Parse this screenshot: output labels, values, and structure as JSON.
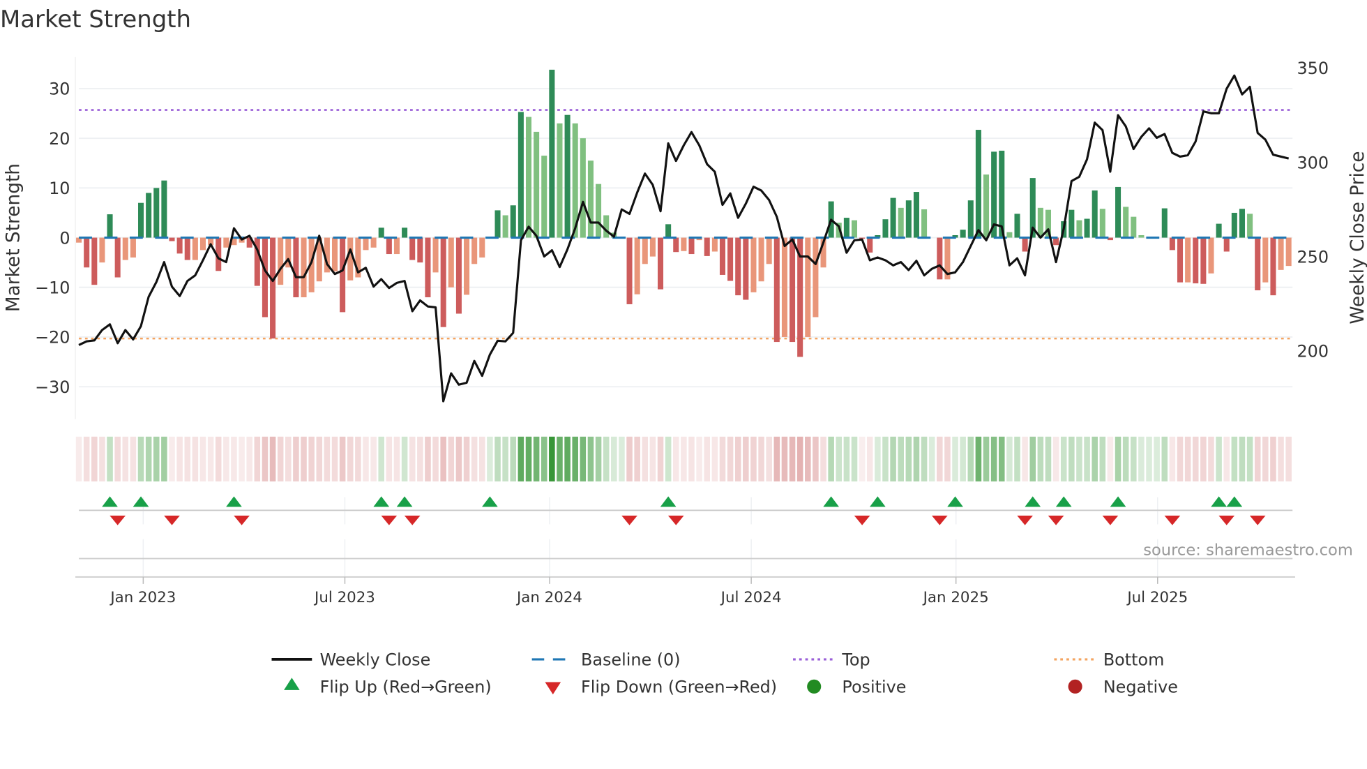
{
  "chart_data": {
    "type": "bar",
    "title": "Market Strength",
    "ylabel": "Market Strength",
    "y2label": "Weekly Close Price",
    "ylim": [
      -36,
      37
    ],
    "y2lim": [
      170,
      357
    ],
    "yticks": [
      -30,
      -20,
      -10,
      0,
      10,
      20,
      30
    ],
    "y2ticks": [
      200,
      250,
      300,
      350
    ],
    "xticks": [
      {
        "label": "Jan 2023",
        "week": 8.3
      },
      {
        "label": "Jul 2023",
        "week": 34.3
      },
      {
        "label": "Jan 2024",
        "week": 60.7
      },
      {
        "label": "Jul 2024",
        "week": 86.7
      },
      {
        "label": "Jan 2025",
        "week": 113.1
      },
      {
        "label": "Jul 2025",
        "week": 139.1
      }
    ],
    "top_level": 25.7,
    "bottom_level": -20.3,
    "baseline": 0,
    "strength": [
      -1,
      -6,
      -9.5,
      -5,
      4.7,
      -8,
      -4.5,
      -4,
      7,
      9,
      10,
      11.5,
      -0.7,
      -3.2,
      -4.5,
      -4.5,
      -2.5,
      -1.5,
      -6.7,
      -2,
      -1.5,
      -1,
      -2,
      -9.7,
      -16,
      -20.3,
      -9.5,
      -6,
      -12,
      -12,
      -11,
      -8.8,
      -7,
      -6.8,
      -15,
      -8.6,
      -8,
      -2.5,
      -2,
      2,
      -3.3,
      -3.3,
      2,
      -4.5,
      -5,
      -12,
      -7,
      -18,
      -10,
      -15.3,
      -11.5,
      -5.3,
      -4,
      0,
      5.5,
      4.5,
      6.5,
      25.3,
      24.3,
      21.3,
      16.5,
      33.8,
      23,
      24.7,
      23,
      20,
      15.5,
      10.8,
      4.5,
      1,
      0,
      -13.4,
      -11.4,
      -5.3,
      -3.8,
      -10.4,
      2.7,
      -2.9,
      -2.7,
      -3.3,
      -0.5,
      -3.7,
      -2.8,
      -7.5,
      -8.7,
      -11.6,
      -12.5,
      -11,
      -8.8,
      -5.3,
      -21,
      -20,
      -21,
      -24,
      -20,
      -16,
      -6,
      7.3,
      3,
      4,
      3.5,
      -0.2,
      -3,
      0.5,
      3.7,
      8,
      6,
      7.5,
      9.2,
      5.7,
      0,
      -8.4,
      -8.4,
      0.5,
      1.6,
      7.5,
      21.7,
      12.7,
      17.3,
      17.5,
      1.1,
      4.8,
      -2.8,
      12,
      6,
      5.6,
      -1.5,
      3.3,
      5.6,
      3.5,
      3.8,
      9.5,
      5.8,
      -0.5,
      10.2,
      6.2,
      4.2,
      0.5,
      0,
      0,
      5.9,
      -2.5,
      -9,
      -9,
      -9.2,
      -9.3,
      -7.2,
      2.8,
      -2.8,
      5,
      5.8,
      4.8,
      -10.6,
      -9,
      -11.6,
      -6.5,
      -5.7
    ],
    "weekly_close": [
      203,
      205,
      205.5,
      211,
      214,
      204,
      211,
      206,
      213,
      228.6,
      236.5,
      247,
      234,
      229,
      237,
      240,
      248,
      256.5,
      249,
      247,
      265,
      259,
      261,
      253.7,
      242.6,
      237,
      243.5,
      248.6,
      239,
      239,
      247,
      261,
      246,
      240.7,
      242.6,
      253.7,
      241.6,
      244,
      234,
      238,
      233.3,
      236,
      237,
      221,
      226.7,
      223.5,
      223,
      173.2,
      188,
      182,
      183,
      194.6,
      186.7,
      197.9,
      205.3,
      205,
      209.5,
      258.6,
      265.8,
      261,
      250,
      253.3,
      244.4,
      253.7,
      265,
      279,
      268,
      268,
      263.7,
      260.5,
      275,
      272.6,
      284,
      294,
      288,
      274,
      310,
      300.7,
      309,
      316,
      309,
      299,
      295,
      277.4,
      283.5,
      270.5,
      278,
      287,
      285,
      280,
      271,
      255.6,
      259,
      250,
      250,
      246,
      257.4,
      269.5,
      266,
      252,
      258.6,
      259,
      248,
      249.5,
      248,
      245.3,
      247,
      242.8,
      247.7,
      240,
      243.5,
      245.3,
      240.7,
      241.6,
      247,
      255.6,
      264,
      258.6,
      267,
      266,
      245.3,
      249,
      240,
      265.3,
      260,
      264.4,
      247,
      265,
      290,
      292.3,
      301.6,
      321,
      317,
      295,
      325,
      319,
      307,
      313.5,
      318,
      313,
      315,
      305,
      303,
      303.7,
      311,
      327,
      326,
      326,
      339,
      346,
      336,
      340,
      315.6,
      312,
      304,
      303,
      302
    ],
    "flip_up_weeks": [
      4,
      8,
      20,
      39,
      42,
      53,
      76,
      97,
      103,
      113,
      123,
      127,
      134,
      147,
      149
    ],
    "flip_down_weeks": [
      5,
      12,
      21,
      40,
      43,
      71,
      77,
      101,
      111,
      122,
      126,
      133,
      141,
      148,
      152
    ],
    "colors": {
      "rising_positive": "#2e8b57",
      "falling_positive": "#80c080",
      "falling_negative": "#cd5c5c",
      "rising_negative": "#e9967a",
      "close": "#111111",
      "baseline": "#1f77b4",
      "top": "#9a5fd8",
      "bottom": "#f4a460",
      "flip_up": "#18a048",
      "flip_down": "#d62728",
      "positive": "#228b22",
      "negative": "#b22222"
    },
    "legend": {
      "placement": "bottom",
      "close": "Weekly Close",
      "baseline": "Baseline (0)",
      "top": "Top",
      "bottom": "Bottom",
      "flip_up": "Flip Up (Red→Green)",
      "flip_down": "Flip Down (Green→Red)",
      "positive": "Positive",
      "negative": "Negative"
    },
    "source": "source: sharemaestro.com"
  }
}
